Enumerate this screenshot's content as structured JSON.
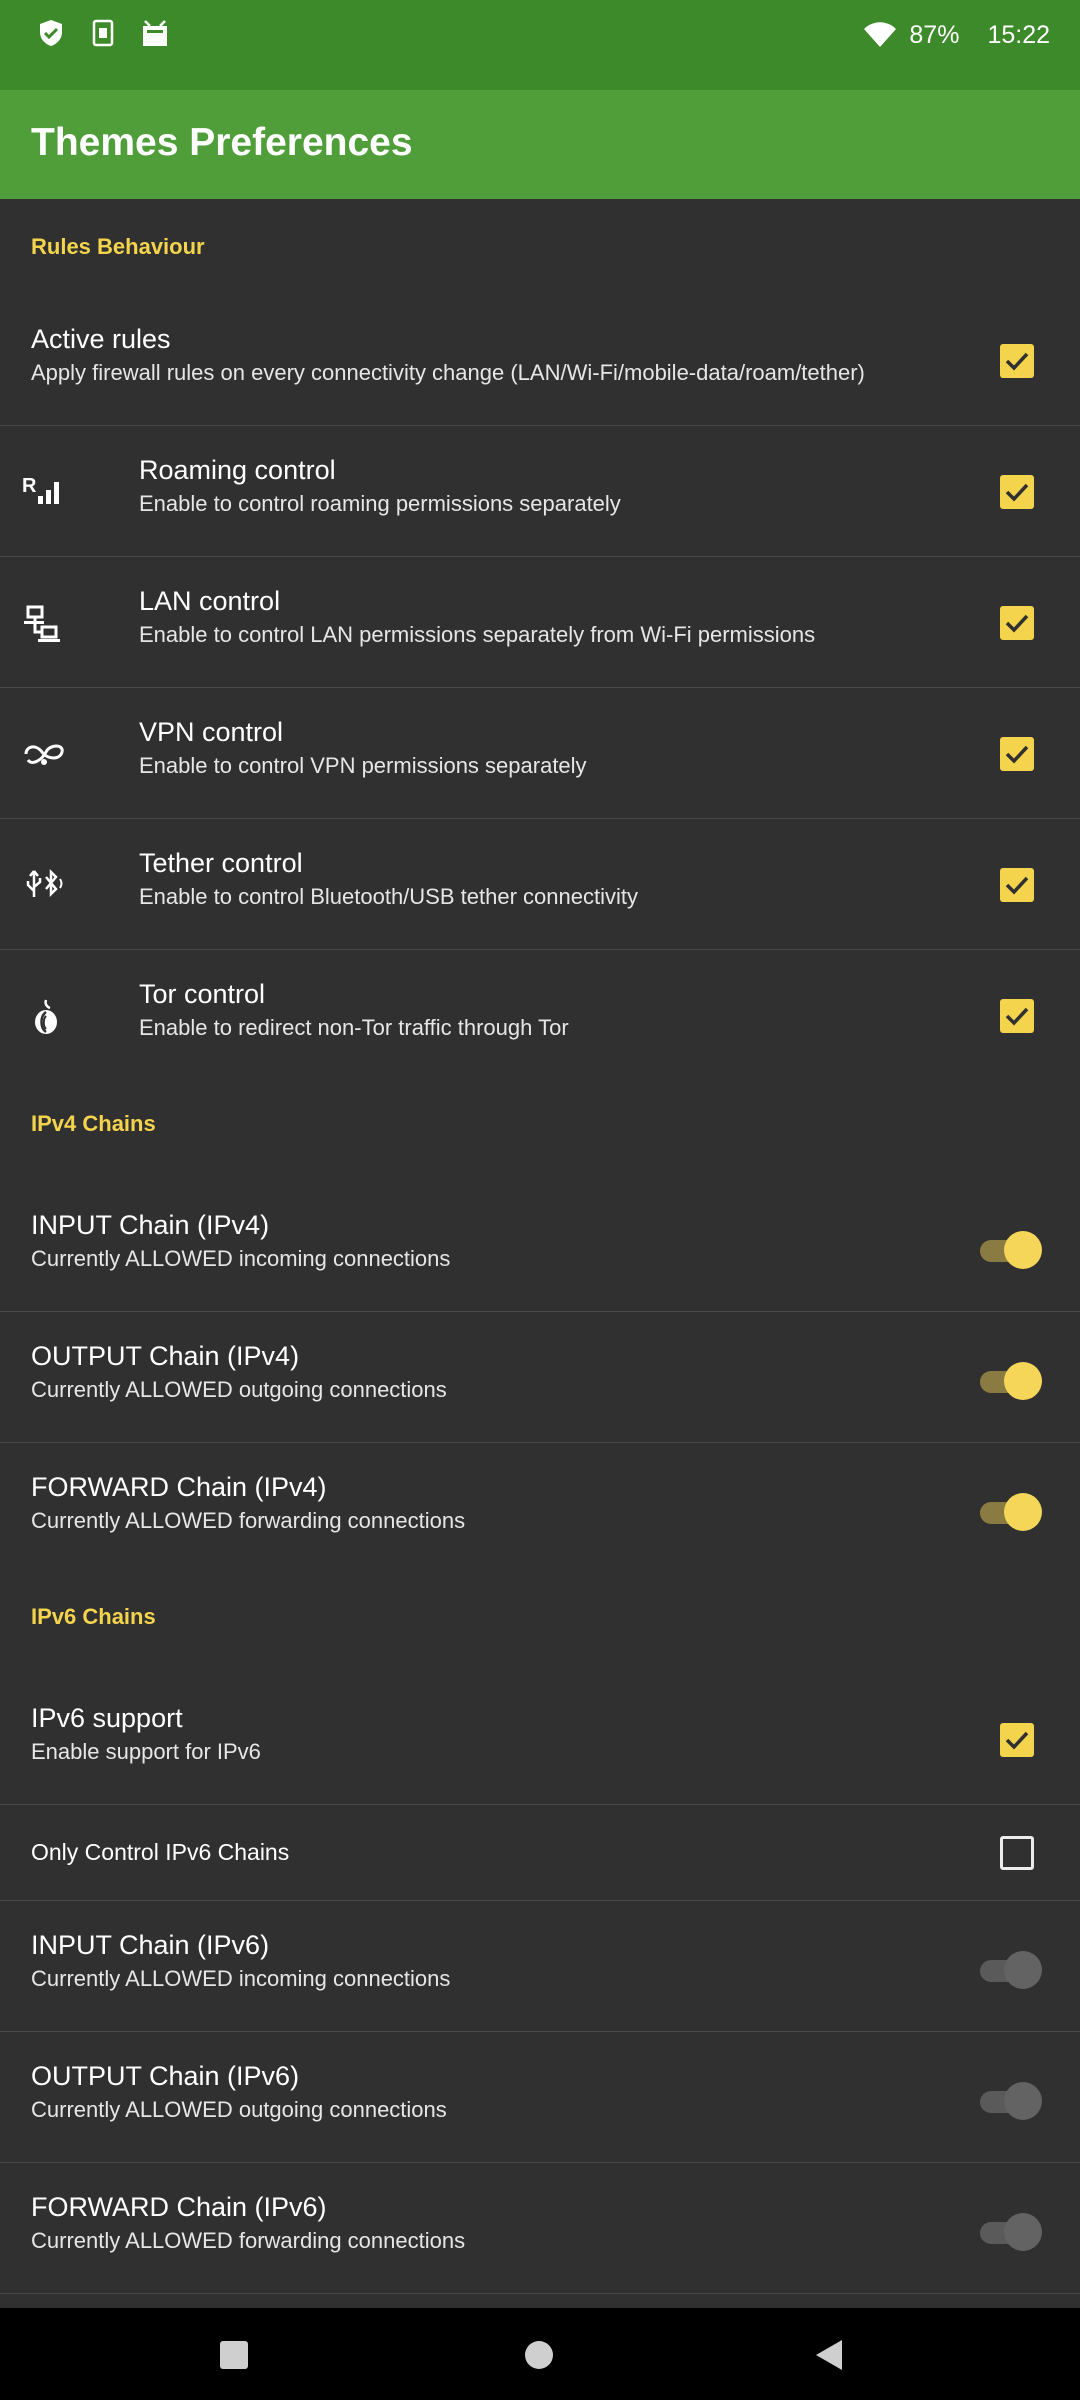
{
  "status_bar": {
    "left_icons": [
      "shield-check-icon",
      "sim-card-icon",
      "app-notification-icon"
    ],
    "battery_percent": "87%",
    "time": "15:22"
  },
  "app_bar": {
    "title": "Themes Preferences"
  },
  "colors": {
    "status_bar": "#3d8a2b",
    "app_bar": "#4f9e3a",
    "background": "#303030",
    "accent": "#f4d44c"
  },
  "sections": {
    "rules": {
      "header": "Rules Behaviour",
      "items": [
        {
          "title": "Active rules",
          "summary": "Apply firewall rules on every connectivity change (LAN/Wi-Fi/mobile-data/roam/tether)",
          "checked": true
        },
        {
          "title": "Roaming control",
          "summary": "Enable to control roaming permissions separately",
          "icon": "roaming-signal-icon",
          "checked": true
        },
        {
          "title": "LAN control",
          "summary": "Enable to control LAN permissions separately from Wi-Fi permissions",
          "icon": "lan-network-icon",
          "checked": true
        },
        {
          "title": "VPN control",
          "summary": "Enable to control VPN permissions separately",
          "icon": "vpn-icon",
          "checked": true
        },
        {
          "title": "Tether control",
          "summary": "Enable to control Bluetooth/USB tether connectivity",
          "icon": "usb-bluetooth-icon",
          "checked": true
        },
        {
          "title": "Tor control",
          "summary": "Enable to redirect non-Tor traffic through Tor",
          "icon": "tor-onion-icon",
          "checked": true
        }
      ]
    },
    "ipv4": {
      "header": "IPv4 Chains",
      "items": [
        {
          "title": "INPUT Chain (IPv4)",
          "summary": "Currently ALLOWED incoming connections",
          "on": true
        },
        {
          "title": "OUTPUT Chain (IPv4)",
          "summary": "Currently ALLOWED outgoing connections",
          "on": true
        },
        {
          "title": "FORWARD Chain (IPv4)",
          "summary": "Currently ALLOWED forwarding connections",
          "on": true
        }
      ]
    },
    "ipv6": {
      "header": "IPv6 Chains",
      "support": {
        "title": "IPv6 support",
        "summary": "Enable support for IPv6",
        "checked": true
      },
      "only_control": {
        "title": "Only Control IPv6 Chains",
        "checked": false
      },
      "items": [
        {
          "title": "INPUT Chain (IPv6)",
          "summary": "Currently ALLOWED incoming connections",
          "on": false
        },
        {
          "title": "OUTPUT Chain (IPv6)",
          "summary": "Currently ALLOWED outgoing connections",
          "on": false
        },
        {
          "title": "FORWARD Chain (IPv6)",
          "summary": "Currently ALLOWED forwarding connections",
          "on": false
        }
      ]
    }
  },
  "nav_bar": {
    "buttons": [
      "back-icon",
      "home-icon",
      "recents-icon"
    ]
  }
}
